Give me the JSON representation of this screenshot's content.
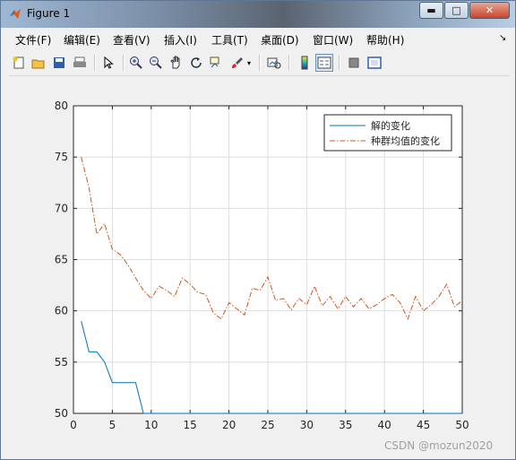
{
  "window": {
    "title": "Figure 1",
    "buttons": {
      "minimize": "▬",
      "maximize": "□",
      "close": "✕"
    }
  },
  "menu": {
    "items": [
      "文件(F)",
      "编辑(E)",
      "查看(V)",
      "插入(I)",
      "工具(T)",
      "桌面(D)",
      "窗口(W)",
      "帮助(H)"
    ],
    "dock_arrow": "↘"
  },
  "toolbar": {
    "icons": [
      "new-figure-icon",
      "open-file-icon",
      "save-icon",
      "print-icon",
      "pointer-icon",
      "zoom-in-icon",
      "zoom-out-icon",
      "pan-hand-icon",
      "rotate-3d-icon",
      "data-cursor-icon",
      "brush-icon",
      "link-plot-icon",
      "colorbar-icon",
      "legend-icon",
      "hide-plot-tools-icon",
      "show-plot-tools-icon"
    ]
  },
  "watermark": "CSDN @mozun2020",
  "chart_data": {
    "type": "line",
    "title": "",
    "xlabel": "",
    "ylabel": "",
    "xlim": [
      0,
      50
    ],
    "ylim": [
      50,
      80
    ],
    "xticks": [
      0,
      5,
      10,
      15,
      20,
      25,
      30,
      35,
      40,
      45,
      50
    ],
    "yticks": [
      50,
      55,
      60,
      65,
      70,
      75,
      80
    ],
    "grid": true,
    "legend_position": "top-right",
    "series": [
      {
        "name": "解的变化",
        "color": "#0072bd",
        "style": "solid",
        "x": [
          1,
          2,
          3,
          4,
          5,
          6,
          7,
          8,
          9,
          10,
          11,
          12,
          13,
          14,
          15,
          16,
          17,
          18,
          19,
          20,
          21,
          22,
          23,
          24,
          25,
          26,
          27,
          28,
          29,
          30,
          31,
          32,
          33,
          34,
          35,
          36,
          37,
          38,
          39,
          40,
          41,
          42,
          43,
          44,
          45,
          46,
          47,
          48,
          49,
          50
        ],
        "y": [
          59,
          56,
          56,
          55,
          53,
          53,
          53,
          53,
          50,
          50,
          50,
          50,
          50,
          50,
          50,
          50,
          50,
          50,
          50,
          50,
          50,
          50,
          50,
          50,
          50,
          50,
          50,
          50,
          50,
          50,
          50,
          50,
          50,
          50,
          50,
          50,
          50,
          50,
          50,
          50,
          50,
          50,
          50,
          50,
          50,
          50,
          50,
          50,
          50,
          50
        ]
      },
      {
        "name": "种群均值的变化",
        "color": "#d95319",
        "style": "dashdot",
        "x": [
          1,
          2,
          3,
          4,
          5,
          6,
          7,
          8,
          9,
          10,
          11,
          12,
          13,
          14,
          15,
          16,
          17,
          18,
          19,
          20,
          21,
          22,
          23,
          24,
          25,
          26,
          27,
          28,
          29,
          30,
          31,
          32,
          33,
          34,
          35,
          36,
          37,
          38,
          39,
          40,
          41,
          42,
          43,
          44,
          45,
          46,
          47,
          48,
          49,
          50
        ],
        "y": [
          75,
          72,
          67.5,
          68.5,
          66,
          65.5,
          64.5,
          63.2,
          62,
          61.2,
          62.4,
          62,
          61.4,
          63.2,
          62.6,
          61.8,
          61.6,
          59.8,
          59.2,
          60.8,
          60.2,
          59.6,
          62.2,
          62,
          63.3,
          61,
          61.2,
          60.1,
          61.2,
          60.6,
          62.4,
          60.5,
          61.4,
          60.2,
          61.4,
          60.4,
          61.2,
          60.2,
          60.6,
          61.2,
          61.6,
          60.8,
          59.2,
          61.4,
          60,
          60.6,
          61.4,
          62.6,
          60.4,
          61
        ]
      }
    ]
  }
}
